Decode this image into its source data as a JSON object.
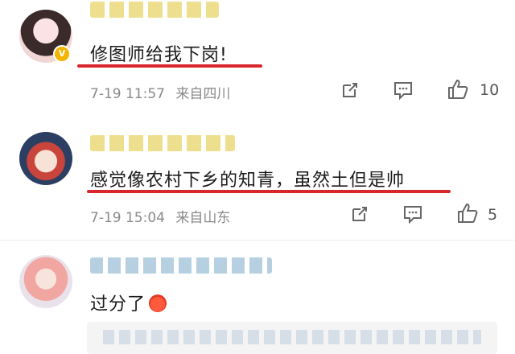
{
  "comments": [
    {
      "text": "修图师给我下岗!",
      "time": "7-19 11:57",
      "location": "来自四川",
      "likes": "10"
    },
    {
      "text": "感觉像农村下乡的知青，虽然土但是帅",
      "time": "7-19 15:04",
      "location": "来自山东",
      "likes": "5"
    },
    {
      "text": "过分了"
    }
  ],
  "icons": {
    "share": "share-icon",
    "comment": "comment-icon",
    "like": "thumbs-up-icon",
    "verified": "verified-v-badge",
    "emoji": "angry-face-emoji"
  },
  "colors": {
    "underline": "#d8262d",
    "meta": "#8a8a8a",
    "verified": "#f5b400"
  }
}
